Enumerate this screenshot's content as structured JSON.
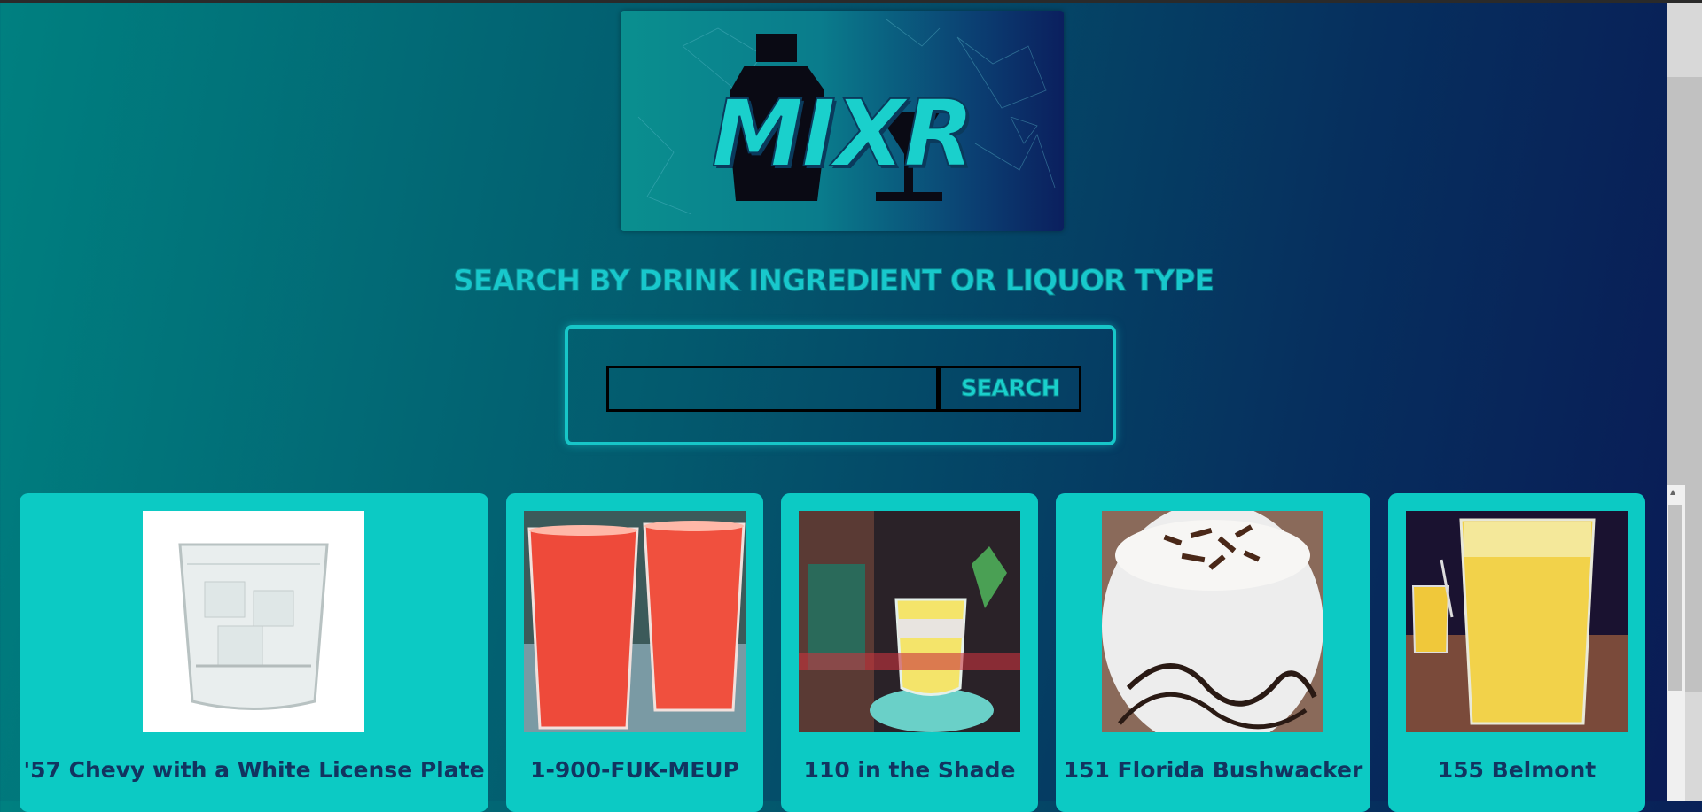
{
  "logo": {
    "text": "MIXR"
  },
  "heading": "Search by drink ingredient or liquor type",
  "search": {
    "button_label": "Search",
    "value": "",
    "placeholder": ""
  },
  "cards": [
    {
      "name": "'57 Chevy with a White License Plate",
      "image": "glass-of-ice-water"
    },
    {
      "name": "1-900-FUK-MEUP",
      "image": "two-red-cups"
    },
    {
      "name": "110 in the Shade",
      "image": "yellow-drink-with-bottle"
    },
    {
      "name": "151 Florida Bushwacker",
      "image": "chocolate-shake"
    },
    {
      "name": "155 Belmont",
      "image": "orange-highball"
    }
  ],
  "colors": {
    "accent": "#17c6c8",
    "card_bg": "#0ccac4",
    "card_text": "#123460",
    "bg_start": "#008080",
    "bg_end": "#0a1a55"
  }
}
